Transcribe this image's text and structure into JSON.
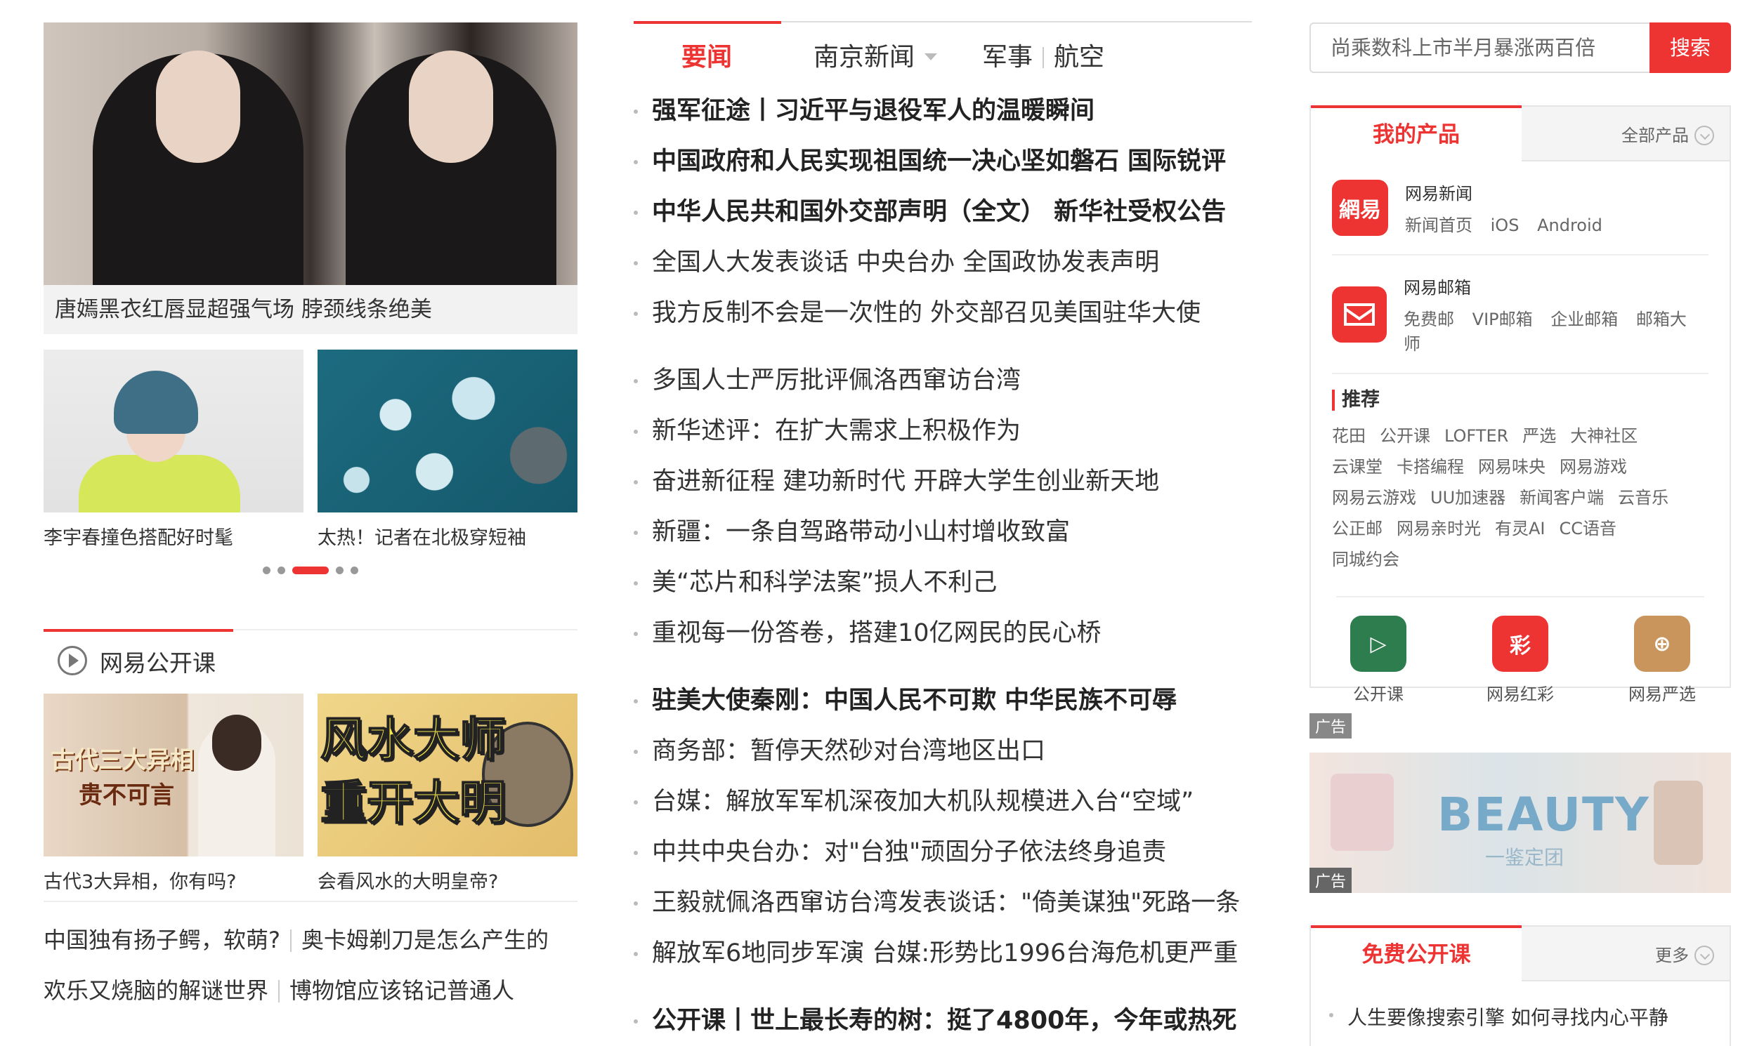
{
  "left": {
    "hero_caption": "唐嫣黑衣红唇显超强气场 脖颈线条绝美",
    "thumbs": [
      {
        "caption": "李宇春撞色搭配好时髦"
      },
      {
        "caption": "太热！记者在北极穿短袖"
      }
    ],
    "carousel_dots": 5,
    "carousel_active": 2,
    "open_course": {
      "title": "网易公开课",
      "cards": [
        {
          "img_text1": "古代三大异相",
          "img_text2": "贵不可言",
          "caption": "古代3大异相，你有吗?"
        },
        {
          "img_text1": "风水大师",
          "img_text2": "重开大明",
          "caption": "会看风水的大明皇帝?"
        }
      ],
      "links": [
        [
          "中国独有扬子鳄，软萌?",
          "奥卡姆剃刀是怎么产生的"
        ],
        [
          "欢乐又烧脑的解谜世界",
          "博物馆应该铭记普通人"
        ]
      ]
    }
  },
  "middle": {
    "tabs": {
      "important": "要闻",
      "nanjing": "南京新闻",
      "military": "军事",
      "aviation": "航空"
    },
    "groups": [
      [
        {
          "text": "强军征途丨习近平与退役军人的温暖瞬间",
          "bold": true
        },
        {
          "text": "中国政府和人民实现祖国统一决心坚如磐石 国际锐评",
          "bold": true
        },
        {
          "text": "中华人民共和国外交部声明（全文） 新华社受权公告",
          "bold": true
        },
        {
          "text": "全国人大发表谈话 中央台办 全国政协发表声明",
          "bold": false
        },
        {
          "text": "我方反制不会是一次性的 外交部召见美国驻华大使",
          "bold": false
        }
      ],
      [
        {
          "text": "多国人士严厉批评佩洛西窜访台湾",
          "bold": false
        },
        {
          "text": "新华述评：在扩大需求上积极作为",
          "bold": false
        },
        {
          "text": "奋进新征程 建功新时代 开辟大学生创业新天地",
          "bold": false
        },
        {
          "text": "新疆：一条自驾路带动小山村增收致富",
          "bold": false
        },
        {
          "text": "美“芯片和科学法案”损人不利己",
          "bold": false
        },
        {
          "text": "重视每一份答卷，搭建10亿网民的民心桥",
          "bold": false
        }
      ],
      [
        {
          "text": "驻美大使秦刚：中国人民不可欺 中华民族不可辱",
          "bold": true
        },
        {
          "text": "商务部：暂停天然砂对台湾地区出口",
          "bold": false
        },
        {
          "text": "台媒：解放军军机深夜加大机队规模进入台“空域”",
          "bold": false
        },
        {
          "text": "中共中央台办：对\"台独\"顽固分子依法终身追责",
          "bold": false
        },
        {
          "text": "王毅就佩洛西窜访台湾发表谈话：\"倚美谋独\"死路一条",
          "bold": false
        },
        {
          "text": "解放军6地同步军演 台媒:形势比1996台海危机更严重",
          "bold": false
        }
      ],
      [
        {
          "text": "公开课丨世上最长寿的树：挺了4800年，今年或热死",
          "bold": true
        }
      ]
    ]
  },
  "right": {
    "search": {
      "placeholder": "尚乘数科上市半月暴涨两百倍",
      "button": "搜索"
    },
    "products_tab": "我的产品",
    "all_products": "全部产品",
    "products": [
      {
        "name": "网易新闻",
        "logo_text": "網易",
        "links": [
          "新闻首页",
          "iOS",
          "Android"
        ]
      },
      {
        "name": "网易邮箱",
        "logo_text": "",
        "links": [
          "免费邮",
          "VIP邮箱",
          "企业邮箱",
          "邮箱大师"
        ]
      }
    ],
    "recommend_title": "推荐",
    "recommend": [
      [
        "花田",
        "公开课",
        "LOFTER",
        "严选",
        "大神社区"
      ],
      [
        "云课堂",
        "卡搭编程",
        "网易味央",
        "网易游戏"
      ],
      [
        "网易云游戏",
        "UU加速器",
        "新闻客户端",
        "云音乐"
      ],
      [
        "公正邮",
        "网易亲时光",
        "有灵AI",
        "CC语音"
      ],
      [
        "同城约会"
      ]
    ],
    "apps": [
      {
        "label": "公开课",
        "glyph": "▷",
        "color": "#2e7d4f"
      },
      {
        "label": "网易红彩",
        "glyph": "彩",
        "color": "#e33"
      },
      {
        "label": "网易严选",
        "glyph": "⊕",
        "color": "#c9955c"
      }
    ],
    "ad_label": "广告",
    "ad_text": "BEAUTY",
    "ad_sub": "一鉴定团",
    "ad_tag": "广告",
    "free_course_tab": "免费公开课",
    "more": "更多",
    "free_course_item": "人生要像搜索引擎 如何寻找内心平静"
  }
}
